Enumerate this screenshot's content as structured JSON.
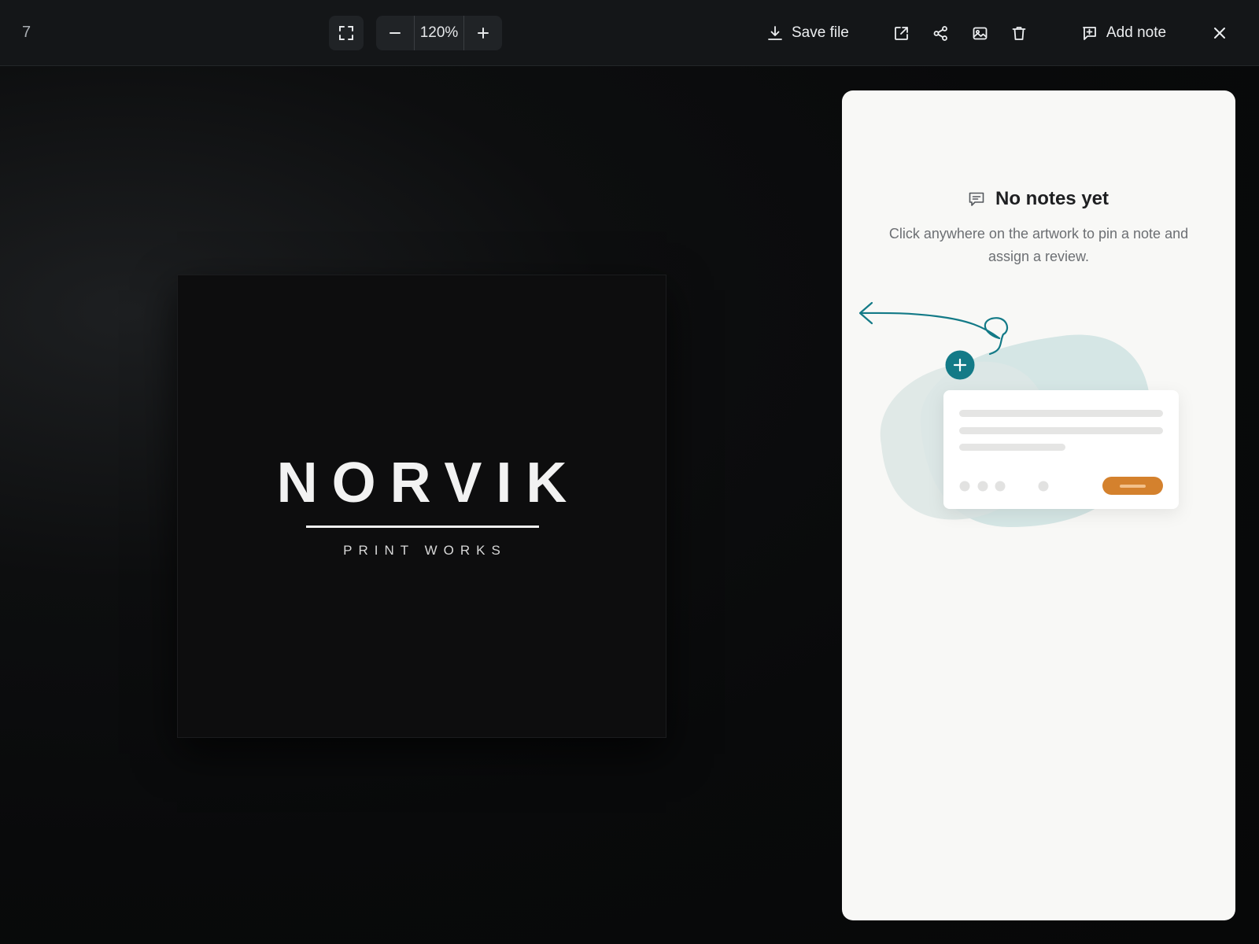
{
  "toolbar": {
    "page_number": "7",
    "zoom_level": "120%",
    "save_label": "Save file",
    "add_note_label": "Add note",
    "icons": {
      "fullscreen": "fullscreen-icon",
      "zoom_out": "minus-icon",
      "zoom_in": "plus-icon",
      "download": "download-icon",
      "open_external": "external-link-icon",
      "share": "share-icon",
      "image": "image-icon",
      "delete": "trash-icon",
      "add_note": "add-note-icon",
      "close": "close-icon"
    }
  },
  "artwork": {
    "brand_name": "NORVIK",
    "tagline": "PRINT WORKS"
  },
  "notes_panel": {
    "empty_title": "No notes yet",
    "empty_description": "Click anywhere on the artwork to pin a note and assign a review.",
    "icon": "comment-icon"
  },
  "colors": {
    "accent_teal": "#137a87",
    "accent_orange": "#d4812d",
    "panel_bg": "#f8f8f6",
    "toolbar_bg": "#141618"
  }
}
